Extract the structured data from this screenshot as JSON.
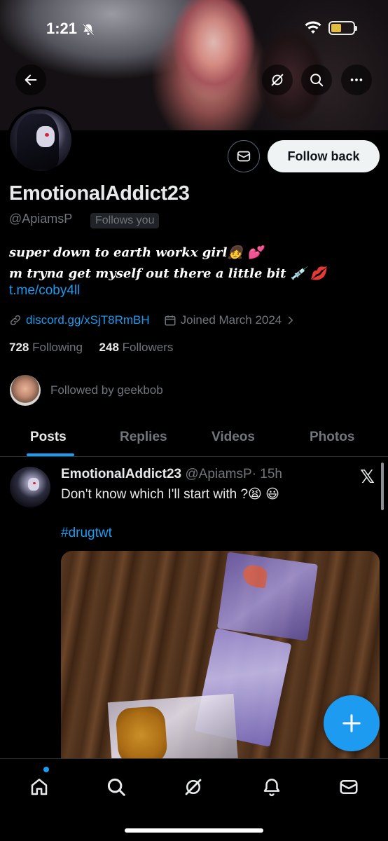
{
  "status_bar": {
    "time": "1:21"
  },
  "profile": {
    "display_name": "EmotionalAddict23",
    "handle": "@ApiamsP",
    "follows_you_badge": "Follows you",
    "follow_button_label": "Follow back",
    "bio_line1": "super down to earth workx girl👧 💕",
    "bio_line2": "m tryna get myself out there a little bit 💉 💋",
    "bio_link": "t.me/coby4ll",
    "website": "discord.gg/xSjT8RmBH",
    "joined": "Joined March 2024",
    "following_count": "728",
    "following_label": "Following",
    "followers_count": "248",
    "followers_label": "Followers",
    "followed_by": "Followed by geekbob"
  },
  "tabs": [
    {
      "label": "Posts",
      "active": true
    },
    {
      "label": "Replies",
      "active": false
    },
    {
      "label": "Videos",
      "active": false
    },
    {
      "label": "Photos",
      "active": false
    }
  ],
  "tweet": {
    "author_name": "EmotionalAddict23",
    "author_handle": "@ApiamsP",
    "time": "· 15h",
    "text": "Don't know which I'll start with ?😫 😃",
    "hashtag": "#drugtwt"
  },
  "icons": {
    "back": "arrow-left-icon",
    "grok": "grok-icon",
    "search": "search-icon",
    "more": "more-icon",
    "message": "envelope-icon",
    "compose": "plus-icon",
    "nav": [
      "home-icon",
      "search-icon",
      "grok-icon",
      "bell-icon",
      "envelope-icon"
    ]
  },
  "colors": {
    "accent": "#1d9bf0",
    "background": "#000000",
    "text_primary": "#e7e9ea",
    "text_secondary": "#71767b"
  }
}
